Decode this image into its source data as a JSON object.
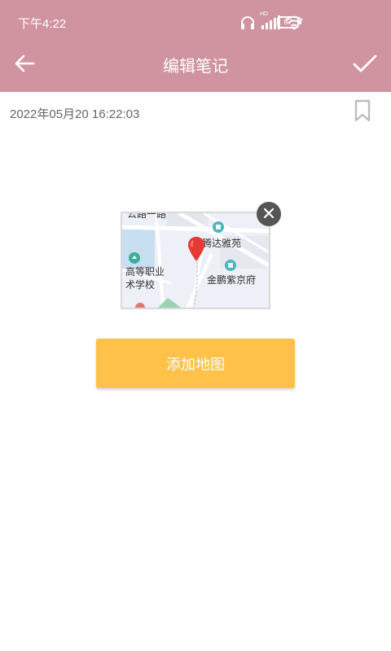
{
  "status_bar": {
    "time": "下午4:22",
    "battery": "87",
    "network_badge": "HD"
  },
  "toolbar": {
    "title": "编辑笔记"
  },
  "note": {
    "datetime": "2022年05月20 16:22:03"
  },
  "map_preview": {
    "labels": {
      "top_cut": "公路一路",
      "poi_1": "腾达雅苑",
      "poi_2": "金鹏紫京府",
      "school_line1": "高等职业",
      "school_line2": "术学校"
    }
  },
  "actions": {
    "add_map": "添加地图"
  },
  "colors": {
    "header": "#cf949f",
    "button": "#fec149",
    "pin": "#e53935"
  },
  "icons": {
    "back": "arrow-left-icon",
    "confirm": "check-icon",
    "bookmark": "bookmark-icon",
    "close": "close-icon"
  }
}
